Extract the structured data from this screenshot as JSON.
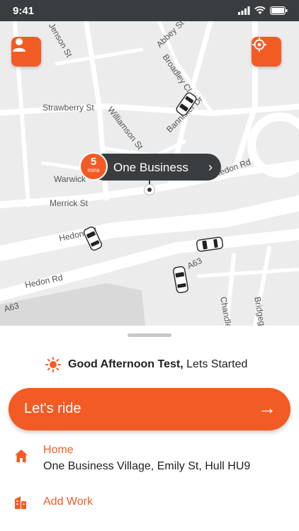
{
  "status_bar": {
    "time": "9:41"
  },
  "map": {
    "streets": [
      "Merrick St",
      "Strawberry St",
      "Williamson St",
      "Abbey St",
      "Broadley Cl",
      "Bannister Dr",
      "Hedon Rd",
      "Hedon Rd",
      "Hedon Rd",
      "A63",
      "A63",
      "Warwick",
      "Chandler",
      "Bridgegate",
      "Jenson St"
    ],
    "pickup": {
      "eta_value": "5",
      "eta_unit": "mins",
      "name": "One Business"
    }
  },
  "sheet": {
    "greeting_bold": "Good Afternoon Test,",
    "greeting_rest": " Lets Started",
    "ride_label": "Let's ride",
    "ride_arrow": "→",
    "home_label": "Home",
    "home_address": "One Business Village, Emily St, Hull HU9",
    "work_label": "Add Work"
  },
  "colors": {
    "accent": "#f35b24",
    "dark": "#3a3d40"
  }
}
